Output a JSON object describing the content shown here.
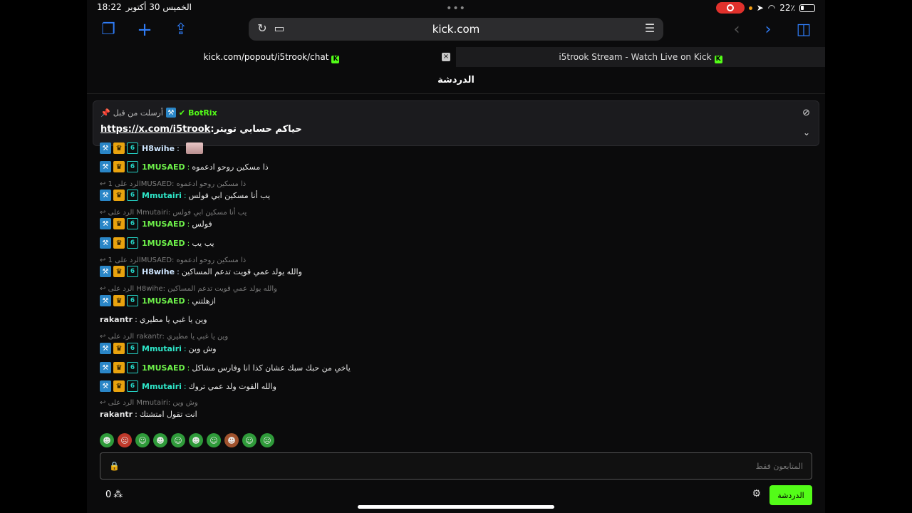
{
  "status": {
    "time": "18:22",
    "date": "الخميس 30 أكتوبر",
    "battery": "22٪"
  },
  "toolbar": {
    "url": "kick.com"
  },
  "tabs": [
    {
      "label": "kick.com/popout/i5trook/chat"
    },
    {
      "label": "i5trook Stream - Watch Live on Kick"
    }
  ],
  "chat": {
    "title": "الدردشة"
  },
  "pinned": {
    "user": "BotRix",
    "sent_label": "أرسلت من قبل",
    "link": "https://x.com/i5trook",
    "text": ":حياكم حسابي تويتر"
  },
  "messages": [
    {
      "user": "H8wihe",
      "text": ""
    },
    {
      "user": "1MUSAED",
      "text": "ذا مسكين روحو ادعموه"
    },
    {
      "reply": "الرد على 1MUSAED: ذا مسكين روحو ادعموه",
      "user": "Mmutairi",
      "text": "يب أنا مسكين ابي فولس"
    },
    {
      "reply": "الرد على Mmutairi: يب أنا مسكين ابي فولس",
      "user": "1MUSAED",
      "text": "فولس"
    },
    {
      "user": "1MUSAED",
      "text": "يب يب"
    },
    {
      "reply": "الرد على 1MUSAED: ذا مسكين روحو ادعموه",
      "user": "H8wihe",
      "text": "والله يولد عمي قويت تدعم المساكين"
    },
    {
      "reply": "الرد على H8wihe: والله يولد عمي قويت تدعم المساكين",
      "user": "1MUSAED",
      "text": "ازهلتني"
    },
    {
      "user": "rakantr",
      "text": "وين يا غبي يا مطيري"
    },
    {
      "reply": "الرد على rakantr: وين يا غبي يا مطيري",
      "user": "Mmutairi",
      "text": "وش وين"
    },
    {
      "user": "1MUSAED",
      "text": "ياخي من حبك سبك عشان كذا انا وفارس مشاكل"
    },
    {
      "user": "Mmutairi",
      "text": "والله القوت ولد عمي تروك"
    },
    {
      "reply": "الرد على Mmutairi: وش وين",
      "user": "rakantr",
      "text": "انت تقول امتشتك"
    }
  ],
  "input": {
    "placeholder": "المتابعون فقط"
  },
  "bottom": {
    "viewers": "0",
    "chat_button": "الدردشة"
  }
}
